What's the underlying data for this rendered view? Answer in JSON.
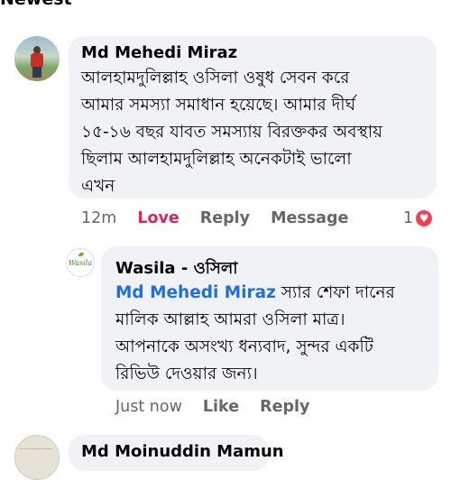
{
  "sort": {
    "label": "Newest"
  },
  "comments": [
    {
      "author": "Md Mehedi Miraz",
      "text": "আলহামদুলিল্লাহ  ওসিলা ওষুধ সেবন করে\nআমার সমস্যা সমাধান হয়েছে। আমার   দীর্ঘ\n১৫-১৬ বছর যাবত সমস্যায়  বিরক্তকর অবস্থায়\nছিলাম  আলহামদুলিল্লাহ অনেকটাই ভালো\nএখন",
      "time": "12m",
      "actions": {
        "love": "Love",
        "reply": "Reply",
        "message": "Message"
      },
      "reaction_count": "1"
    },
    {
      "author": "Wasila - ওসিলা",
      "mention": "Md Mehedi Miraz",
      "text": " স্যার শেফা দানের\nমালিক আল্লাহ আমরা ওসিলা মাত্র।\nআপনাকে অসংখ্য ধন্যবাদ, সুন্দর একটি\nরিভিউ দেওয়ার জন্য।",
      "time": "Just now",
      "actions": {
        "like": "Like",
        "reply": "Reply"
      },
      "avatar_logo": "Wasila"
    },
    {
      "author": "Md Moinuddin Mamun"
    }
  ],
  "colors": {
    "bubble": "#f0f2f5",
    "love": "#e0245e",
    "mention": "#216fdb",
    "muted": "#65676b",
    "heart": "#f33e58"
  },
  "icons": {
    "sort": "chevron-down-icon",
    "reaction": "heart-icon"
  }
}
